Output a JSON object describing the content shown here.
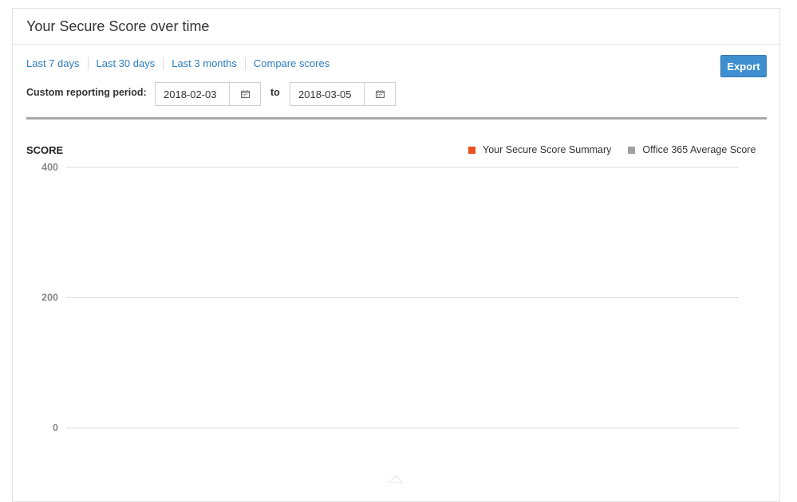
{
  "panel": {
    "title": "Your Secure Score over time"
  },
  "range_links": [
    {
      "label": "Last 7 days"
    },
    {
      "label": "Last 30 days"
    },
    {
      "label": "Last 3 months"
    },
    {
      "label": "Compare scores"
    }
  ],
  "toolbar": {
    "export_label": "Export"
  },
  "custom_period": {
    "label": "Custom reporting period:",
    "from_value": "2018-02-03",
    "to_label": "to",
    "to_value": "2018-03-05"
  },
  "icons": {
    "calendar": "calendar-icon"
  },
  "colors": {
    "link": "#2f7dc0",
    "export_button": "#3f8fd0",
    "series_secure_score": "#e8501c",
    "series_office_average": "#a0a0a0",
    "gridline": "#dedede"
  },
  "chart_data": {
    "type": "line",
    "ylabel": "SCORE",
    "ylim": [
      0,
      400
    ],
    "yticks": [
      "400",
      "200",
      "0"
    ],
    "grid": true,
    "legend_position": "top-right",
    "series": [
      {
        "name": "Your Secure Score Summary",
        "values": []
      },
      {
        "name": "Office 365 Average Score",
        "values": []
      }
    ]
  }
}
